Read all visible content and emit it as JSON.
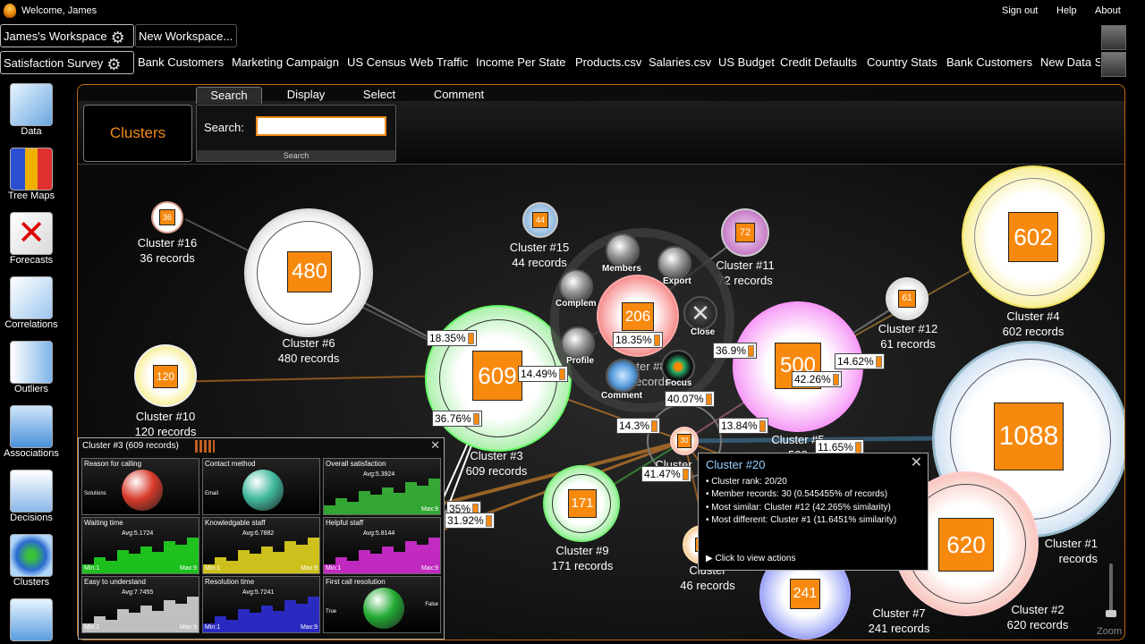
{
  "topbar": {
    "welcome": "Welcome, James",
    "signout": "Sign out",
    "help": "Help",
    "about": "About"
  },
  "workspace_tabs": [
    "James's Workspace",
    "New Workspace..."
  ],
  "dataset_tabs": [
    "Satisfaction Survey",
    "Bank Customers",
    "Marketing Campaign",
    "US Census",
    "Web Traffic",
    "Income Per State",
    "Products.csv",
    "Salaries.csv",
    "US Budget",
    "Credit Defaults",
    "Country Stats",
    "Bank Customers",
    "New Data S"
  ],
  "sidebar": [
    {
      "label": "Data",
      "icon": "data-chart-icon"
    },
    {
      "label": "Tree Maps",
      "icon": "treemap-icon"
    },
    {
      "label": "Forecasts",
      "icon": "forecast-icon"
    },
    {
      "label": "Correlations",
      "icon": "correlation-icon"
    },
    {
      "label": "Outliers",
      "icon": "outlier-icon"
    },
    {
      "label": "Associations",
      "icon": "association-icon"
    },
    {
      "label": "Decisions",
      "icon": "decision-icon"
    },
    {
      "label": "Clusters",
      "icon": "cluster-icon"
    },
    {
      "label": "",
      "icon": "network-icon"
    }
  ],
  "panel": {
    "tabs": [
      "Search",
      "Display",
      "Select",
      "Comment"
    ],
    "title": "Clusters",
    "search_label": "Search:",
    "search_value": "",
    "search_button": "Search"
  },
  "clusters": {
    "c16": {
      "num": "36",
      "name": "Cluster #16",
      "records": "36 records"
    },
    "c6": {
      "num": "480",
      "name": "Cluster #6",
      "records": "480 records"
    },
    "c15": {
      "num": "44",
      "name": "Cluster #15",
      "records": "44 records"
    },
    "c11": {
      "num": "72",
      "name": "Cluster #11",
      "records": "72 records"
    },
    "c4": {
      "num": "602",
      "name": "Cluster #4",
      "records": "602 records"
    },
    "c12": {
      "num": "61",
      "name": "Cluster #12",
      "records": "61 records"
    },
    "c10": {
      "num": "120",
      "name": "Cluster #10",
      "records": "120 records"
    },
    "c3": {
      "num": "609",
      "name": "Cluster #3",
      "records": "609 records"
    },
    "c8": {
      "num": "206",
      "name": "Cluster #8",
      "records": "206 records"
    },
    "c5": {
      "num": "500",
      "name": "Cluster #5",
      "records": "500"
    },
    "c1": {
      "num": "1088",
      "name": "Cluster #1",
      "records": "records"
    },
    "c20": {
      "num": "30",
      "name": "Cluster",
      "records": ""
    },
    "c9": {
      "num": "171",
      "name": "Cluster #9",
      "records": "171 records"
    },
    "c13": {
      "num": "",
      "name": "Cluster",
      "records": "46 records"
    },
    "c2": {
      "num": "620",
      "name": "Cluster #2",
      "records": "620 records"
    },
    "c7": {
      "num": "241",
      "name": "Cluster #7",
      "records": "241 records"
    }
  },
  "percentages": {
    "p1": "18.35%",
    "p2": "14.49%",
    "p3": "36.76%",
    "p4": "18.35%",
    "p5": "36.9%",
    "p6": "42.26%",
    "p7": "14.62%",
    "p8": "40.07%",
    "p9": "14.3%",
    "p10": "13.84%",
    "p11": "11.65%",
    "p12": "41.47%",
    "p13": "35%",
    "p14": "31.92%"
  },
  "actions": {
    "members": "Members",
    "export": "Export",
    "complement": "Complem",
    "close": "Close",
    "profile": "Profile",
    "focus": "Focus",
    "comment": "Comment"
  },
  "tooltip": {
    "title": "Cluster #20",
    "lines": [
      "• Cluster rank: 20/20",
      "• Member records: 30 (0.545455% of records)",
      "• Most similar: Cluster #12 (42.265% similarity)",
      "• Most different: Cluster #1 (11.6451% similarity)"
    ],
    "action": "▶ Click to view actions"
  },
  "detail": {
    "title": "Cluster #3 (609 records)",
    "cells": [
      {
        "title": "Reason for calling",
        "avg": "",
        "min": "",
        "max": "",
        "kind": "pie",
        "color": "#d83a2a",
        "side": "Solutions"
      },
      {
        "title": "Contact method",
        "avg": "",
        "min": "",
        "max": "",
        "kind": "pie",
        "color": "#3fb89c",
        "side": "Email"
      },
      {
        "title": "Overall satisfaction",
        "avg": "Avg:5.3924",
        "min": "",
        "max": "Max:9",
        "kind": "bar",
        "color": "#3cc23c"
      },
      {
        "title": "Waiting time",
        "avg": "Avg:5.1724",
        "min": "Min:1",
        "max": "Max:9",
        "kind": "bar",
        "color": "#22e022"
      },
      {
        "title": "Knowledgable staff",
        "avg": "Avg:6.7882",
        "min": "Min:1",
        "max": "Max:9",
        "kind": "bar",
        "color": "#f0e020"
      },
      {
        "title": "Helpful staff",
        "avg": "Avg:5.8144",
        "min": "Min:1",
        "max": "Max:9",
        "kind": "bar",
        "color": "#e030e0"
      },
      {
        "title": "Easy to understand",
        "avg": "Avg:7.7455",
        "min": "Min:1",
        "max": "Max:9",
        "kind": "bar",
        "color": "#e0e0e0"
      },
      {
        "title": "Resolution time",
        "avg": "Avg:5.7241",
        "min": "Min:1",
        "max": "Max:9",
        "kind": "bar",
        "color": "#3030e0"
      },
      {
        "title": "First call resolution",
        "avg": "",
        "min": "",
        "max": "",
        "kind": "pie2",
        "color": "#22aa33",
        "side": "True",
        "side2": "False"
      }
    ]
  },
  "zoom_label": "Zoom"
}
